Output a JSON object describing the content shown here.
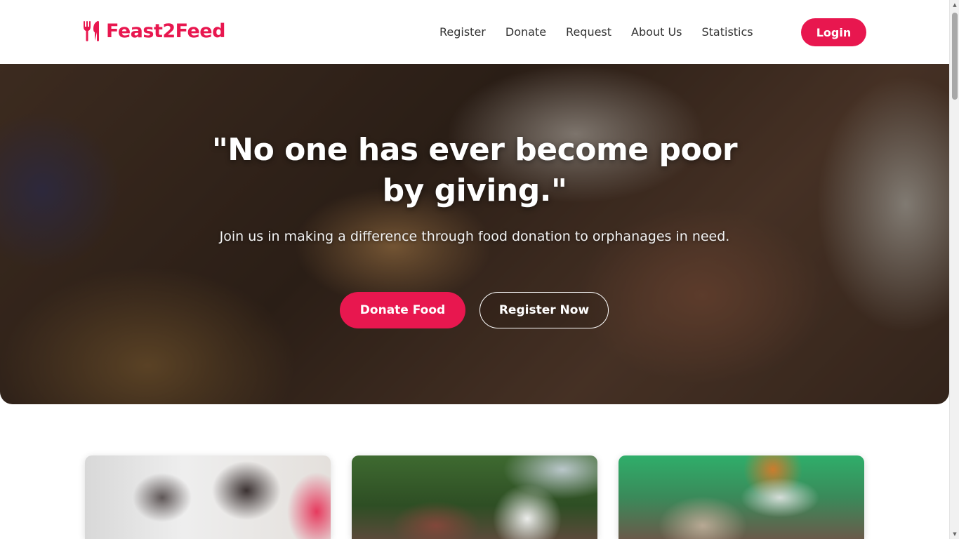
{
  "header": {
    "logo_text": "Feast2Feed",
    "logo_icon": "fork-knife-icon",
    "nav": [
      "Register",
      "Donate",
      "Request",
      "About Us",
      "Statistics"
    ],
    "login_label": "Login"
  },
  "hero": {
    "title": "\"No one has ever become poor by giving.\"",
    "subtitle": "Join us in making a difference through food donation to orphanages in need.",
    "primary_button": "Donate Food",
    "secondary_button": "Register Now"
  },
  "colors": {
    "accent": "#e8174f",
    "text_dark": "#333333",
    "hero_text": "#ffffff"
  }
}
